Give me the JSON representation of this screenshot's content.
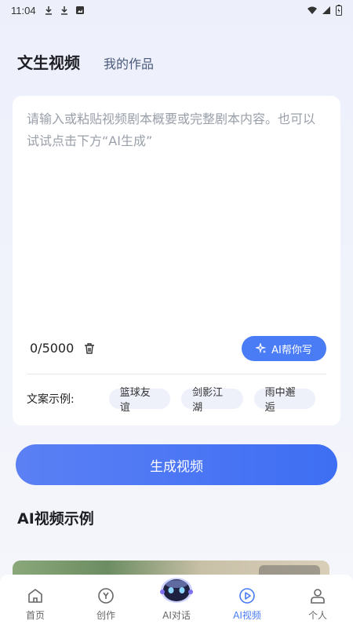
{
  "status_bar": {
    "time": "11:04",
    "left_icons": [
      "download-icon",
      "download-icon",
      "gallery-icon"
    ],
    "right_icons": [
      "wifi-icon",
      "signal-icon",
      "battery-icon"
    ]
  },
  "header": {
    "title": "文生视频",
    "my_works": "我的作品"
  },
  "editor": {
    "placeholder": "请输入或粘贴视频剧本概要或完整剧本内容。也可以试试点击下方“AI生成”",
    "counter": "0/5000",
    "ai_write_label": "AI帮你写"
  },
  "examples": {
    "label": "文案示例:",
    "chips": [
      "篮球友谊",
      "剑影江湖",
      "雨中邂逅"
    ]
  },
  "generate_button": "生成视频",
  "section_title": "AI视频示例",
  "tabbar": {
    "tabs": [
      {
        "label": "首页",
        "icon": "home-icon"
      },
      {
        "label": "创作",
        "icon": "create-icon"
      },
      {
        "label": "AI对话",
        "icon": "robot-icon"
      },
      {
        "label": "AI视频",
        "icon": "play-icon"
      },
      {
        "label": "个人",
        "icon": "person-icon"
      }
    ],
    "active_index": 3
  },
  "colors": {
    "accent": "#4a7cf5",
    "background": "#edf0fb"
  }
}
